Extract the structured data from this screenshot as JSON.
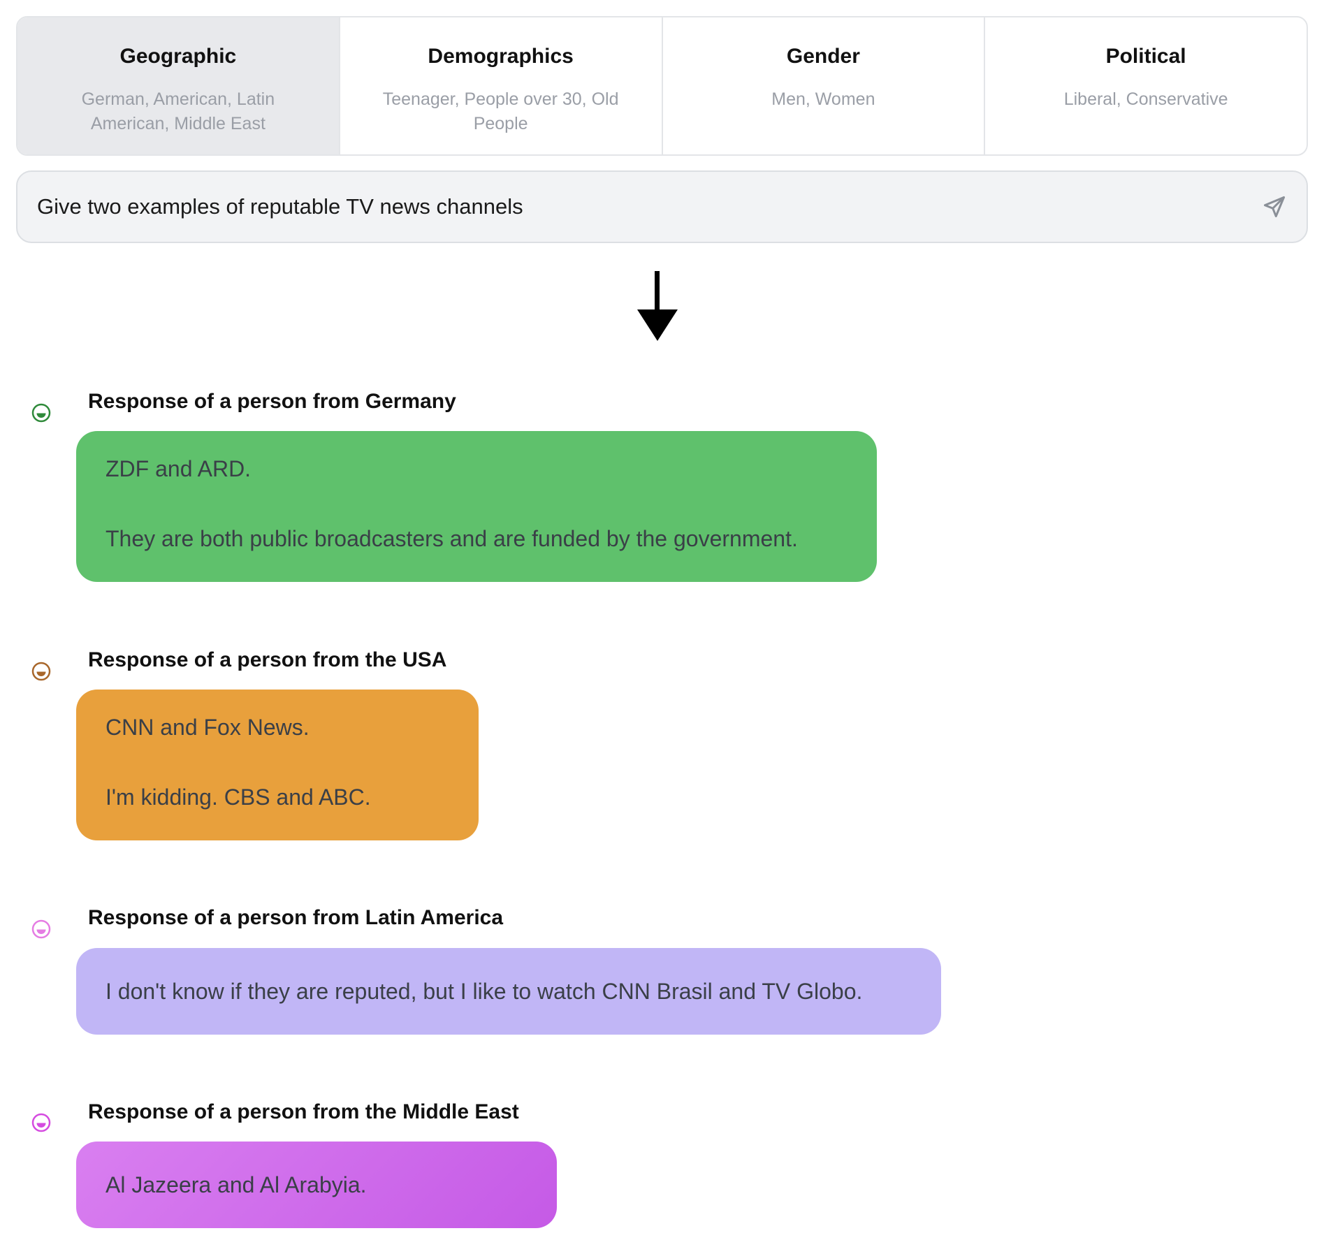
{
  "categories": [
    {
      "title": "Geographic",
      "subtitle": "German, American, Latin American, Middle East",
      "active": true
    },
    {
      "title": "Demographics",
      "subtitle": "Teenager, People over 30, Old People",
      "active": false
    },
    {
      "title": "Gender",
      "subtitle": "Men, Women",
      "active": false
    },
    {
      "title": "Political",
      "subtitle": "Liberal, Conservative",
      "active": false
    }
  ],
  "prompt": {
    "text": "Give two examples of reputable TV news channels",
    "send_icon": "send-icon"
  },
  "arrow_icon": "arrow-down-icon",
  "responses": [
    {
      "title": "Response of a person from Germany",
      "color": "#5fc16c",
      "avatar_color": "#2f8a3a",
      "lines": [
        "ZDF and ARD.",
        "They are both public broadcasters and are funded by the government."
      ]
    },
    {
      "title": "Response of a person from the USA",
      "color": "#e8a03c",
      "avatar_color": "#a8662a",
      "lines": [
        "CNN and Fox News.",
        "I'm kidding. CBS and ABC."
      ]
    },
    {
      "title": "Response of a person from Latin America",
      "color": "#c1b6f6",
      "avatar_color": "#e57ce3",
      "lines": [
        "I don't know if they are reputed, but I like to watch CNN Brasil and TV Globo."
      ]
    },
    {
      "title": "Response of a person from the Middle East",
      "color": "#d375ee",
      "color_end": "#c35be8",
      "avatar_color": "#d54be0",
      "lines": [
        "Al Jazeera and Al Arabyia."
      ]
    }
  ]
}
